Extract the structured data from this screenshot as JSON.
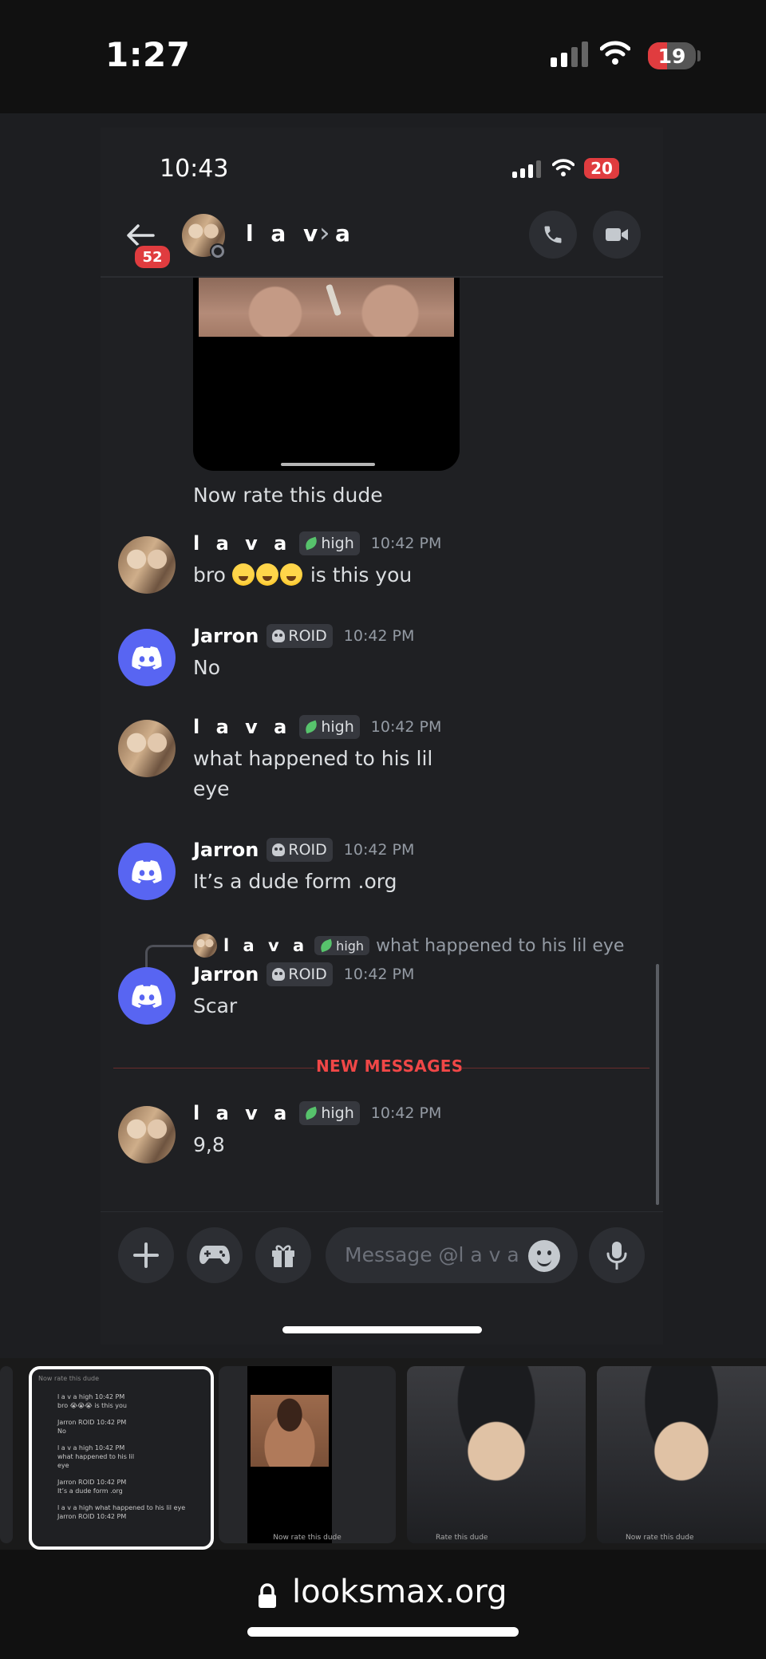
{
  "outer_status": {
    "time": "1:27",
    "battery": "19"
  },
  "inner_status": {
    "time": "10:43",
    "battery": "20"
  },
  "header": {
    "unread_count": "52",
    "dm_name": "l a v a",
    "chevron": "›"
  },
  "image_caption": "Now rate this dude",
  "messages": [
    {
      "author": "l a v a",
      "badge": "high",
      "time": "10:42 PM",
      "text": "bro",
      "text_after": "is this you"
    },
    {
      "author": "Jarron",
      "badge": "ROID",
      "time": "10:42 PM",
      "text": "No"
    },
    {
      "author": "l a v a",
      "badge": "high",
      "time": "10:42 PM",
      "text_line1": "what happened to his lil",
      "text_line2": "eye"
    },
    {
      "author": "Jarron",
      "badge": "ROID",
      "time": "10:42 PM",
      "text": "It’s a dude form .org"
    },
    {
      "reply_author": "l a v a",
      "reply_badge": "high",
      "reply_text": "what happened to his lil eye",
      "author": "Jarron",
      "badge": "ROID",
      "time": "10:42 PM",
      "text": "Scar"
    },
    {
      "author": "l a v a",
      "badge": "high",
      "time": "10:42 PM",
      "text": "9,8"
    }
  ],
  "new_messages_label": "NEW MESSAGES",
  "composer": {
    "placeholder": "Message @l a v a"
  },
  "thumbnails": {
    "t2_caption": "Now rate this dude",
    "t3_caption": "Rate this dude",
    "t4_caption": "Now rate this dude",
    "mini_chat": [
      "l a v a  high  10:42 PM",
      "bro 😭😭😭 is this you",
      "Jarron  ROID  10:42 PM",
      "No",
      "l a v a  high  10:42 PM",
      "what happened to his lil",
      "eye",
      "Jarron  ROID  10:42 PM",
      "It’s a dude form .org",
      "l a v a high what happened to his lil eye",
      "Jarron ROID 10:42 PM"
    ]
  },
  "url": "looksmax.org",
  "colors": {
    "discord_blurple": "#5865f2",
    "unread_red": "#e03c3f",
    "new_messages_red": "#f04747",
    "high_leaf": "#57c36c"
  }
}
